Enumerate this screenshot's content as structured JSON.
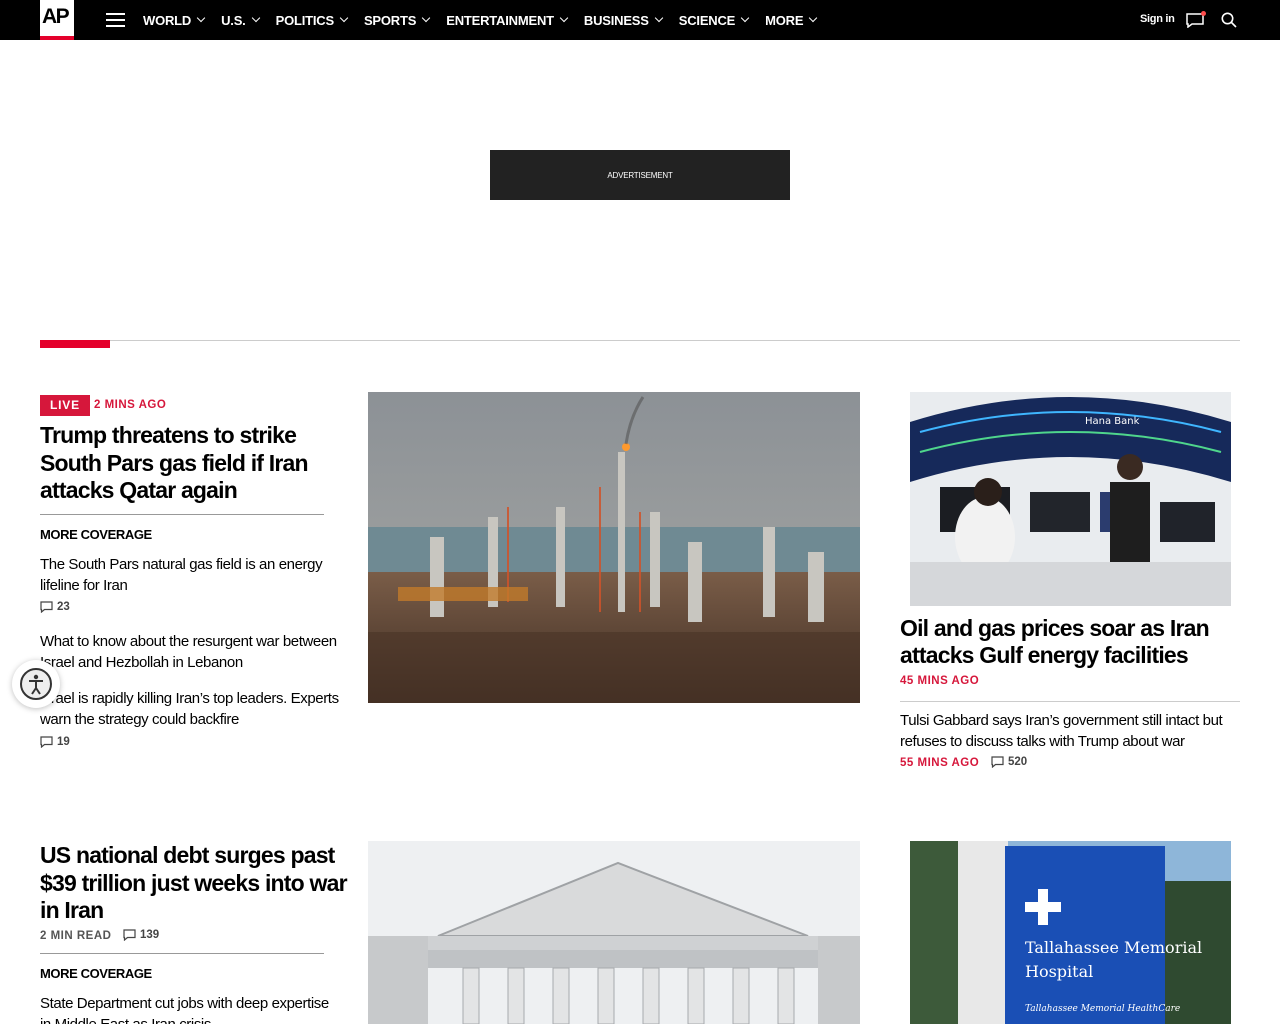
{
  "header": {
    "logo_text": "AP",
    "nav": [
      {
        "label": "WORLD"
      },
      {
        "label": "U.S."
      },
      {
        "label": "POLITICS"
      },
      {
        "label": "SPORTS"
      },
      {
        "label": "ENTERTAINMENT"
      },
      {
        "label": "BUSINESS"
      },
      {
        "label": "SCIENCE"
      },
      {
        "label": "MORE"
      }
    ],
    "sign_in": "Sign in",
    "icons": [
      "menu-icon",
      "chevron-down-icon",
      "message-icon",
      "search-icon"
    ]
  },
  "ad": {
    "label": "ADVERTISEMENT"
  },
  "colors": {
    "brand_red": "#e4002b",
    "live_red": "#d6173b",
    "nav_bg": "#000000"
  },
  "lead": {
    "badge": "LIVE",
    "time": "2 MINS AGO",
    "headline": "Trump threatens to strike South Pars gas field if Iran attacks Qatar again",
    "more_coverage": "MORE COVERAGE",
    "related": [
      {
        "title": "The South Pars natural gas field is an energy lifeline for Iran",
        "comments": "23"
      },
      {
        "title": "What to know about the resurgent war between Israel and Hezbollah in Lebanon",
        "comments": ""
      },
      {
        "title": "Israel is rapidly killing Iran’s top leaders. Experts warn the strategy could backfire",
        "comments": "19"
      }
    ]
  },
  "right": {
    "headline": "Oil and gas prices soar as Iran attacks Gulf energy facilities",
    "time": "45 MINS AGO",
    "sub_headline": "Tulsi Gabbard says Iran’s government still intact but refuses to discuss talks with Trump about war",
    "sub_time": "55 MINS AGO",
    "sub_comments": "520"
  },
  "second": {
    "headline": "US national debt surges past $39 trillion just weeks into war in Iran",
    "read_time": "2 MIN READ",
    "comments": "139",
    "more_coverage": "MORE COVERAGE",
    "related_title": "State Department cut jobs with deep expertise in Middle East as Iran crisis"
  },
  "images": {
    "refinery_sign": "Hana Bank",
    "hospital_sign_1": "Tallahassee Memorial",
    "hospital_sign_2": "Hospital",
    "hospital_sign_3": "Tallahassee Memorial HealthCare"
  }
}
